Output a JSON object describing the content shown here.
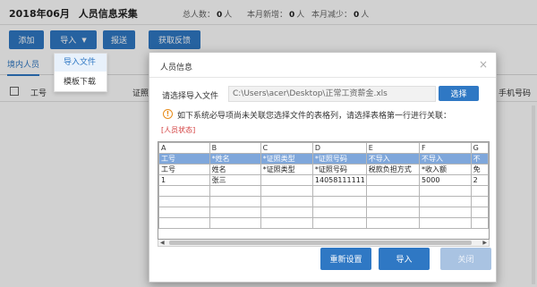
{
  "header": {
    "period": "2018年06月",
    "title": "人员信息采集",
    "stats": [
      {
        "label": "总人数：",
        "value": "0",
        "unit": "人"
      },
      {
        "label": "本月新增：",
        "value": "0",
        "unit": "人"
      },
      {
        "label": "本月减少：",
        "value": "0",
        "unit": "人"
      }
    ]
  },
  "toolbar": {
    "add": "添加",
    "import": "导入",
    "submit": "报送",
    "feedback": "获取反馈"
  },
  "import_menu": [
    "导入文件",
    "模板下载"
  ],
  "tabs": [
    "境内人员"
  ],
  "table_headers": [
    "工号",
    "证照",
    "手机号码"
  ],
  "modal": {
    "title": "人员信息",
    "file_label": "请选择导入文件",
    "file_path": "C:\\Users\\acer\\Desktop\\正常工资薪金.xls",
    "select_button": "选择",
    "warning": "如下系统必导项尚未关联您选择文件的表格列，请选择表格第一行进行关联：",
    "status_tag": "[人员状态]",
    "grid": {
      "columns": [
        "A",
        "B",
        "C",
        "D",
        "E",
        "F",
        "G"
      ],
      "rows": [
        [
          "工号",
          "*姓名",
          "*证照类型",
          "*证照号码",
          "不导入",
          "不导入",
          "不"
        ],
        [
          "工号",
          "姓名",
          "*证照类型",
          "*证照号码",
          "税款负担方式",
          "*收入额",
          "免"
        ],
        [
          "1",
          "张三",
          "",
          "14058111111",
          "",
          "5000",
          "2"
        ],
        [
          "",
          "",
          "",
          "",
          "",
          "",
          ""
        ],
        [
          "",
          "",
          "",
          "",
          "",
          "",
          ""
        ],
        [
          "",
          "",
          "",
          "",
          "",
          "",
          ""
        ],
        [
          "",
          "",
          "",
          "",
          "",
          "",
          ""
        ]
      ]
    },
    "buttons": {
      "reset": "重新设置",
      "import": "导入",
      "close": "关闭"
    }
  }
}
